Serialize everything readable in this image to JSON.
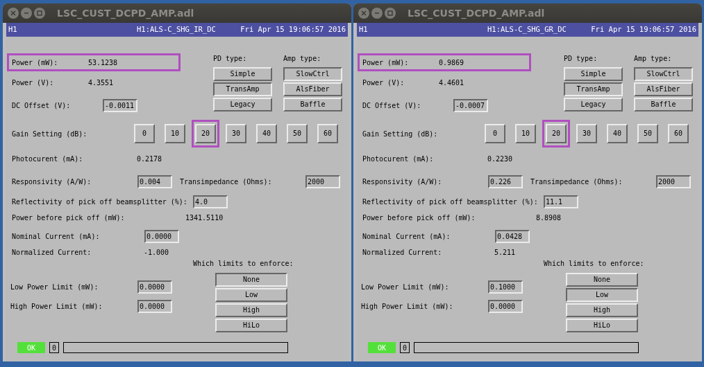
{
  "windows": [
    {
      "title": "LSC_CUST_DCPD_AMP.adl",
      "header": {
        "site": "H1",
        "channel": "H1:ALS-C_SHG_IR_DC",
        "timestamp": "Fri Apr 15 19:06:57 2016"
      },
      "power_mw": {
        "label": "Power (mW):",
        "value": "53.1238"
      },
      "power_v": {
        "label": "Power (V):",
        "value": "4.3551"
      },
      "dc_offset": {
        "label": "DC Offset (V):",
        "value": "-0.0011"
      },
      "pd_type": {
        "label": "PD type:",
        "options": [
          {
            "label": "Simple",
            "selected": false
          },
          {
            "label": "TransAmp",
            "selected": true
          },
          {
            "label": "Legacy",
            "selected": false
          }
        ]
      },
      "amp_type": {
        "label": "Amp type:",
        "options": [
          {
            "label": "SlowCtrl",
            "selected": true
          },
          {
            "label": "AlsFiber",
            "selected": false
          },
          {
            "label": "Baffle",
            "selected": false
          }
        ]
      },
      "gain": {
        "label": "Gain Setting (dB):",
        "options": [
          {
            "label": "0",
            "selected": false
          },
          {
            "label": "10",
            "selected": false
          },
          {
            "label": "20",
            "selected": true
          },
          {
            "label": "30",
            "selected": false
          },
          {
            "label": "40",
            "selected": false
          },
          {
            "label": "50",
            "selected": false
          },
          {
            "label": "60",
            "selected": false
          }
        ]
      },
      "photocurrent": {
        "label": "Photocurent (mA):",
        "value": "0.2178"
      },
      "responsivity": {
        "label": "Responsivity (A/W):",
        "value": "0.004"
      },
      "transimpedance": {
        "label": "Transimpedance (Ohms):",
        "value": "2000"
      },
      "reflectivity": {
        "label": "Reflectivity of pick off beamsplitter (%):",
        "value": "4.0"
      },
      "power_before_pickoff": {
        "label": "Power before pick off (mW):",
        "value": "1341.5110"
      },
      "nominal_current": {
        "label": "Nominal Current (mA):",
        "value": "0.0000"
      },
      "normalized_current": {
        "label": "Normalized Current:",
        "value": "-1.000"
      },
      "limits": {
        "label": "Which limits to enforce:",
        "options": [
          {
            "label": "None",
            "selected": true
          },
          {
            "label": "Low",
            "selected": false
          },
          {
            "label": "High",
            "selected": false
          },
          {
            "label": "HiLo",
            "selected": false
          }
        ]
      },
      "low_power_limit": {
        "label": "Low Power Limit (mW):",
        "value": "0.0000"
      },
      "high_power_limit": {
        "label": "High Power Limit (mW):",
        "value": "0.0000"
      },
      "status": {
        "label": "OK",
        "count": "0"
      }
    },
    {
      "title": "LSC_CUST_DCPD_AMP.adl",
      "header": {
        "site": "H1",
        "channel": "H1:ALS-C_SHG_GR_DC",
        "timestamp": "Fri Apr 15 19:06:57 2016"
      },
      "power_mw": {
        "label": "Power (mW):",
        "value": "0.9869"
      },
      "power_v": {
        "label": "Power (V):",
        "value": "4.4601"
      },
      "dc_offset": {
        "label": "DC Offset (V):",
        "value": "-0.0007"
      },
      "pd_type": {
        "label": "PD type:",
        "options": [
          {
            "label": "Simple",
            "selected": false
          },
          {
            "label": "TransAmp",
            "selected": true
          },
          {
            "label": "Legacy",
            "selected": false
          }
        ]
      },
      "amp_type": {
        "label": "Amp type:",
        "options": [
          {
            "label": "SlowCtrl",
            "selected": true
          },
          {
            "label": "AlsFiber",
            "selected": false
          },
          {
            "label": "Baffle",
            "selected": false
          }
        ]
      },
      "gain": {
        "label": "Gain Setting (dB):",
        "options": [
          {
            "label": "0",
            "selected": false
          },
          {
            "label": "10",
            "selected": false
          },
          {
            "label": "20",
            "selected": true
          },
          {
            "label": "30",
            "selected": false
          },
          {
            "label": "40",
            "selected": false
          },
          {
            "label": "50",
            "selected": false
          },
          {
            "label": "60",
            "selected": false
          }
        ]
      },
      "photocurrent": {
        "label": "Photocurent (mA):",
        "value": "0.2230"
      },
      "responsivity": {
        "label": "Responsivity (A/W):",
        "value": "0.226"
      },
      "transimpedance": {
        "label": "Transimpedance (Ohms):",
        "value": "2000"
      },
      "reflectivity": {
        "label": "Reflectivity of pick off beamsplitter (%):",
        "value": "11.1"
      },
      "power_before_pickoff": {
        "label": "Power before pick off (mW):",
        "value": "8.8908"
      },
      "nominal_current": {
        "label": "Nominal Current (mA):",
        "value": "0.0428"
      },
      "normalized_current": {
        "label": "Normalized Current:",
        "value": "5.211"
      },
      "limits": {
        "label": "Which limits to enforce:",
        "options": [
          {
            "label": "None",
            "selected": false
          },
          {
            "label": "Low",
            "selected": true
          },
          {
            "label": "High",
            "selected": false
          },
          {
            "label": "HiLo",
            "selected": false
          }
        ]
      },
      "low_power_limit": {
        "label": "Low Power Limit (mW):",
        "value": "0.1000"
      },
      "high_power_limit": {
        "label": "High Power Limit (mW):",
        "value": "0.0000"
      },
      "status": {
        "label": "OK",
        "count": "0"
      }
    }
  ]
}
